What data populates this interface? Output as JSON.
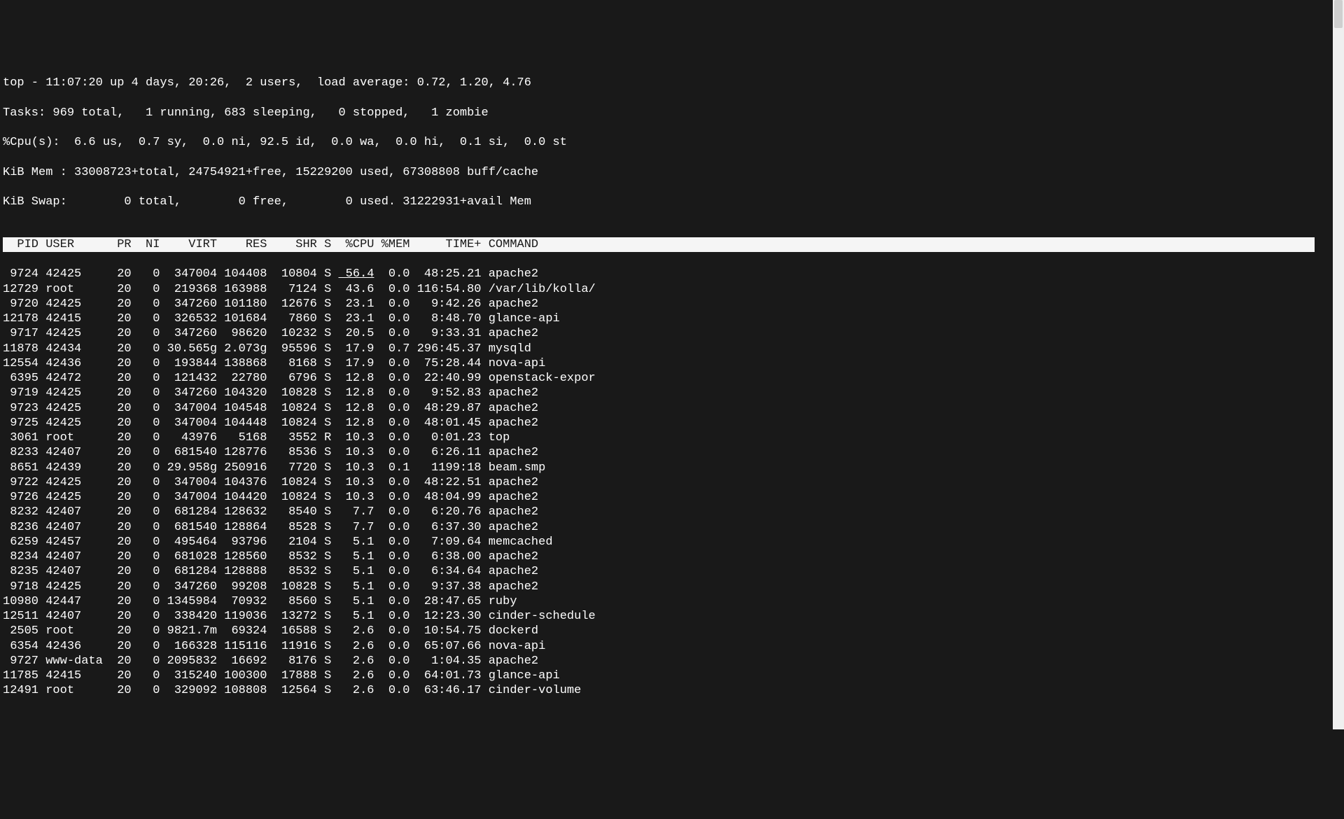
{
  "summary": {
    "line1": "top - 11:07:20 up 4 days, 20:26,  2 users,  load average: 0.72, 1.20, 4.76",
    "line2": "Tasks: 969 total,   1 running, 683 sleeping,   0 stopped,   1 zombie",
    "line3": "%Cpu(s):  6.6 us,  0.7 sy,  0.0 ni, 92.5 id,  0.0 wa,  0.0 hi,  0.1 si,  0.0 st",
    "line4": "KiB Mem : 33008723+total, 24754921+free, 15229200 used, 67308808 buff/cache",
    "line5": "KiB Swap:        0 total,        0 free,        0 used. 31222931+avail Mem"
  },
  "columns": {
    "pid": "PID",
    "user": "USER",
    "pr": "PR",
    "ni": "NI",
    "virt": "VIRT",
    "res": "RES",
    "shr": "SHR",
    "s": "S",
    "cpu": "%CPU",
    "mem": "%MEM",
    "time": "TIME+",
    "command": "COMMAND"
  },
  "processes": [
    {
      "pid": "9724",
      "user": "42425",
      "pr": "20",
      "ni": "0",
      "virt": "347004",
      "res": "104408",
      "shr": "10804",
      "s": "S",
      "cpu": "56.4",
      "mem": "0.0",
      "time": "48:25.21",
      "cmd": "apache2",
      "hl": true
    },
    {
      "pid": "12729",
      "user": "root",
      "pr": "20",
      "ni": "0",
      "virt": "219368",
      "res": "163988",
      "shr": "7124",
      "s": "S",
      "cpu": "43.6",
      "mem": "0.0",
      "time": "116:54.80",
      "cmd": "/var/lib/kolla/"
    },
    {
      "pid": "9720",
      "user": "42425",
      "pr": "20",
      "ni": "0",
      "virt": "347260",
      "res": "101180",
      "shr": "12676",
      "s": "S",
      "cpu": "23.1",
      "mem": "0.0",
      "time": "9:42.26",
      "cmd": "apache2"
    },
    {
      "pid": "12178",
      "user": "42415",
      "pr": "20",
      "ni": "0",
      "virt": "326532",
      "res": "101684",
      "shr": "7860",
      "s": "S",
      "cpu": "23.1",
      "mem": "0.0",
      "time": "8:48.70",
      "cmd": "glance-api"
    },
    {
      "pid": "9717",
      "user": "42425",
      "pr": "20",
      "ni": "0",
      "virt": "347260",
      "res": "98620",
      "shr": "10232",
      "s": "S",
      "cpu": "20.5",
      "mem": "0.0",
      "time": "9:33.31",
      "cmd": "apache2"
    },
    {
      "pid": "11878",
      "user": "42434",
      "pr": "20",
      "ni": "0",
      "virt": "30.565g",
      "res": "2.073g",
      "shr": "95596",
      "s": "S",
      "cpu": "17.9",
      "mem": "0.7",
      "time": "296:45.37",
      "cmd": "mysqld"
    },
    {
      "pid": "12554",
      "user": "42436",
      "pr": "20",
      "ni": "0",
      "virt": "193844",
      "res": "138868",
      "shr": "8168",
      "s": "S",
      "cpu": "17.9",
      "mem": "0.0",
      "time": "75:28.44",
      "cmd": "nova-api"
    },
    {
      "pid": "6395",
      "user": "42472",
      "pr": "20",
      "ni": "0",
      "virt": "121432",
      "res": "22780",
      "shr": "6796",
      "s": "S",
      "cpu": "12.8",
      "mem": "0.0",
      "time": "22:40.99",
      "cmd": "openstack-expor"
    },
    {
      "pid": "9719",
      "user": "42425",
      "pr": "20",
      "ni": "0",
      "virt": "347260",
      "res": "104320",
      "shr": "10828",
      "s": "S",
      "cpu": "12.8",
      "mem": "0.0",
      "time": "9:52.83",
      "cmd": "apache2"
    },
    {
      "pid": "9723",
      "user": "42425",
      "pr": "20",
      "ni": "0",
      "virt": "347004",
      "res": "104548",
      "shr": "10824",
      "s": "S",
      "cpu": "12.8",
      "mem": "0.0",
      "time": "48:29.87",
      "cmd": "apache2"
    },
    {
      "pid": "9725",
      "user": "42425",
      "pr": "20",
      "ni": "0",
      "virt": "347004",
      "res": "104448",
      "shr": "10824",
      "s": "S",
      "cpu": "12.8",
      "mem": "0.0",
      "time": "48:01.45",
      "cmd": "apache2"
    },
    {
      "pid": "3061",
      "user": "root",
      "pr": "20",
      "ni": "0",
      "virt": "43976",
      "res": "5168",
      "shr": "3552",
      "s": "R",
      "cpu": "10.3",
      "mem": "0.0",
      "time": "0:01.23",
      "cmd": "top"
    },
    {
      "pid": "8233",
      "user": "42407",
      "pr": "20",
      "ni": "0",
      "virt": "681540",
      "res": "128776",
      "shr": "8536",
      "s": "S",
      "cpu": "10.3",
      "mem": "0.0",
      "time": "6:26.11",
      "cmd": "apache2"
    },
    {
      "pid": "8651",
      "user": "42439",
      "pr": "20",
      "ni": "0",
      "virt": "29.958g",
      "res": "250916",
      "shr": "7720",
      "s": "S",
      "cpu": "10.3",
      "mem": "0.1",
      "time": "1199:18",
      "cmd": "beam.smp"
    },
    {
      "pid": "9722",
      "user": "42425",
      "pr": "20",
      "ni": "0",
      "virt": "347004",
      "res": "104376",
      "shr": "10824",
      "s": "S",
      "cpu": "10.3",
      "mem": "0.0",
      "time": "48:22.51",
      "cmd": "apache2"
    },
    {
      "pid": "9726",
      "user": "42425",
      "pr": "20",
      "ni": "0",
      "virt": "347004",
      "res": "104420",
      "shr": "10824",
      "s": "S",
      "cpu": "10.3",
      "mem": "0.0",
      "time": "48:04.99",
      "cmd": "apache2"
    },
    {
      "pid": "8232",
      "user": "42407",
      "pr": "20",
      "ni": "0",
      "virt": "681284",
      "res": "128632",
      "shr": "8540",
      "s": "S",
      "cpu": "7.7",
      "mem": "0.0",
      "time": "6:20.76",
      "cmd": "apache2"
    },
    {
      "pid": "8236",
      "user": "42407",
      "pr": "20",
      "ni": "0",
      "virt": "681540",
      "res": "128864",
      "shr": "8528",
      "s": "S",
      "cpu": "7.7",
      "mem": "0.0",
      "time": "6:37.30",
      "cmd": "apache2"
    },
    {
      "pid": "6259",
      "user": "42457",
      "pr": "20",
      "ni": "0",
      "virt": "495464",
      "res": "93796",
      "shr": "2104",
      "s": "S",
      "cpu": "5.1",
      "mem": "0.0",
      "time": "7:09.64",
      "cmd": "memcached"
    },
    {
      "pid": "8234",
      "user": "42407",
      "pr": "20",
      "ni": "0",
      "virt": "681028",
      "res": "128560",
      "shr": "8532",
      "s": "S",
      "cpu": "5.1",
      "mem": "0.0",
      "time": "6:38.00",
      "cmd": "apache2"
    },
    {
      "pid": "8235",
      "user": "42407",
      "pr": "20",
      "ni": "0",
      "virt": "681284",
      "res": "128888",
      "shr": "8532",
      "s": "S",
      "cpu": "5.1",
      "mem": "0.0",
      "time": "6:34.64",
      "cmd": "apache2"
    },
    {
      "pid": "9718",
      "user": "42425",
      "pr": "20",
      "ni": "0",
      "virt": "347260",
      "res": "99208",
      "shr": "10828",
      "s": "S",
      "cpu": "5.1",
      "mem": "0.0",
      "time": "9:37.38",
      "cmd": "apache2"
    },
    {
      "pid": "10980",
      "user": "42447",
      "pr": "20",
      "ni": "0",
      "virt": "1345984",
      "res": "70932",
      "shr": "8560",
      "s": "S",
      "cpu": "5.1",
      "mem": "0.0",
      "time": "28:47.65",
      "cmd": "ruby"
    },
    {
      "pid": "12511",
      "user": "42407",
      "pr": "20",
      "ni": "0",
      "virt": "338420",
      "res": "119036",
      "shr": "13272",
      "s": "S",
      "cpu": "5.1",
      "mem": "0.0",
      "time": "12:23.30",
      "cmd": "cinder-schedule"
    },
    {
      "pid": "2505",
      "user": "root",
      "pr": "20",
      "ni": "0",
      "virt": "9821.7m",
      "res": "69324",
      "shr": "16588",
      "s": "S",
      "cpu": "2.6",
      "mem": "0.0",
      "time": "10:54.75",
      "cmd": "dockerd"
    },
    {
      "pid": "6354",
      "user": "42436",
      "pr": "20",
      "ni": "0",
      "virt": "166328",
      "res": "115116",
      "shr": "11916",
      "s": "S",
      "cpu": "2.6",
      "mem": "0.0",
      "time": "65:07.66",
      "cmd": "nova-api"
    },
    {
      "pid": "9727",
      "user": "www-data",
      "pr": "20",
      "ni": "0",
      "virt": "2095832",
      "res": "16692",
      "shr": "8176",
      "s": "S",
      "cpu": "2.6",
      "mem": "0.0",
      "time": "1:04.35",
      "cmd": "apache2"
    },
    {
      "pid": "11785",
      "user": "42415",
      "pr": "20",
      "ni": "0",
      "virt": "315240",
      "res": "100300",
      "shr": "17888",
      "s": "S",
      "cpu": "2.6",
      "mem": "0.0",
      "time": "64:01.73",
      "cmd": "glance-api"
    },
    {
      "pid": "12491",
      "user": "root",
      "pr": "20",
      "ni": "0",
      "virt": "329092",
      "res": "108808",
      "shr": "12564",
      "s": "S",
      "cpu": "2.6",
      "mem": "0.0",
      "time": "63:46.17",
      "cmd": "cinder-volume"
    }
  ],
  "widths": {
    "pid": 5,
    "user": 9,
    "pr": 3,
    "ni": 4,
    "virt": 8,
    "res": 7,
    "shr": 7,
    "s": 2,
    "cpu": 5,
    "mem": 5,
    "time": 10,
    "cmd": 1
  }
}
